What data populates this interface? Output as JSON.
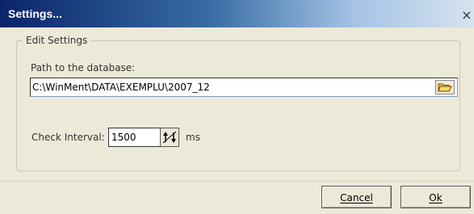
{
  "window": {
    "title": "Settings...",
    "close_glyph": "×"
  },
  "group": {
    "label": "Edit Settings"
  },
  "path": {
    "label": "Path to the database:",
    "value": "C:\\WinMent\\DATA\\EXEMPLU\\2007_12",
    "browse_icon": "folder-open-icon"
  },
  "interval": {
    "label": "Check Interval:",
    "value": "1500",
    "unit": "ms",
    "spinner_icon": "spin-up-down-icon"
  },
  "buttons": {
    "cancel": "Cancel",
    "ok": "Ok"
  },
  "colors": {
    "title_bar": "#0a246a",
    "dialog_bg": "#ece9d8"
  }
}
